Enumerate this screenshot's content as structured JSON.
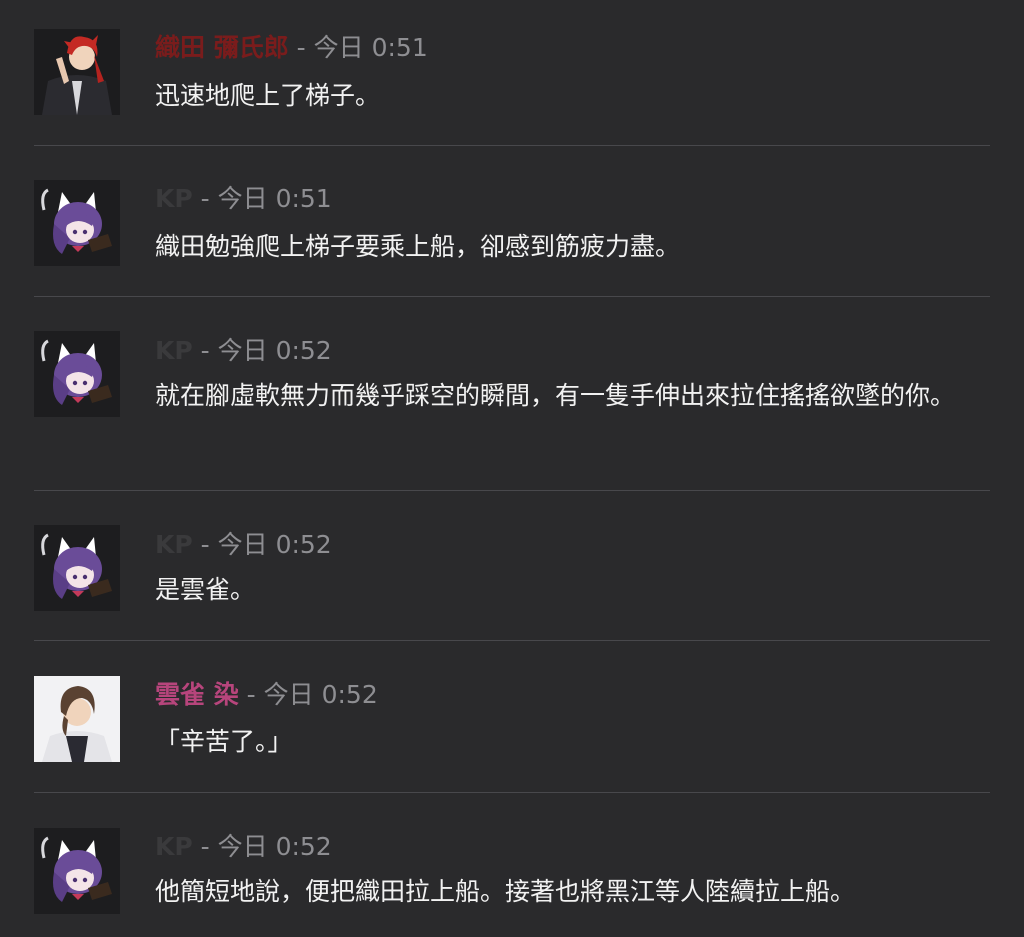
{
  "separator": " - ",
  "messages": [
    {
      "author": "織田 彌氏郎",
      "author_color": "#7a1c1c",
      "avatar": "red-hair-avatar",
      "time": "今日 0:51",
      "text": "迅速地爬上了梯子。"
    },
    {
      "author": "KP",
      "author_color": "#3a3a3c",
      "avatar": "cat-girl-avatar",
      "time": "今日 0:51",
      "text": "織田勉強爬上梯子要乘上船，卻感到筋疲力盡。"
    },
    {
      "author": "KP",
      "author_color": "#3a3a3c",
      "avatar": "cat-girl-avatar",
      "time": "今日 0:52",
      "text": "就在腳虛軟無力而幾乎踩空的瞬間，有一隻手伸出來拉住搖搖欲墜的你。"
    },
    {
      "author": "KP",
      "author_color": "#3a3a3c",
      "avatar": "cat-girl-avatar",
      "time": "今日 0:52",
      "text": "是雲雀。"
    },
    {
      "author": "雲雀 染",
      "author_color": "#b7457c",
      "avatar": "brown-hair-avatar",
      "time": "今日 0:52",
      "text": "「辛苦了。」"
    },
    {
      "author": "KP",
      "author_color": "#3a3a3c",
      "avatar": "cat-girl-avatar",
      "time": "今日 0:52",
      "text": "他簡短地說，便把織田拉上船。接著也將黑江等人陸續拉上船。"
    }
  ]
}
